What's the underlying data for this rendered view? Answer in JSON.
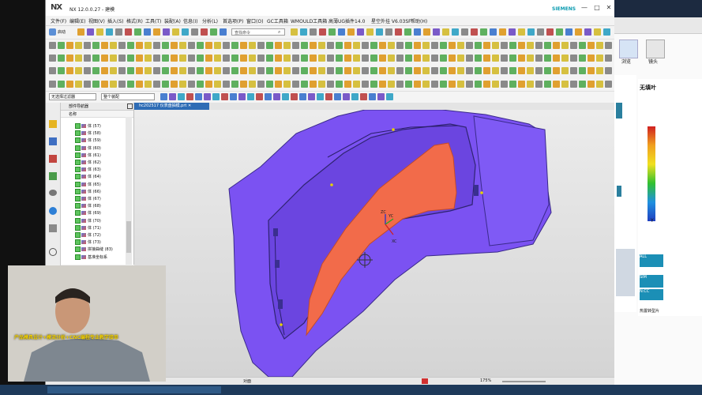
{
  "window": {
    "logo": "NX",
    "title": "NX 12.0.0.27 - 建模",
    "brand": "SIEMENS",
    "controls": [
      "—",
      "□",
      "✕"
    ]
  },
  "menu": [
    "文件(F)",
    "编辑(E)",
    "视图(V)",
    "插入(S)",
    "格式(R)",
    "工具(T)",
    "装配(A)",
    "信息(I)",
    "分析(L)",
    "首选项(P)",
    "窗口(O)",
    "GC工具箱",
    "WMOULD工具箱",
    "高薄UG插件14.0",
    "星空外挂 V6.03SF",
    "帮助(H)"
  ],
  "toolbar": {
    "start_label": "启动",
    "command_search_placeholder": "查找命令"
  },
  "selection": {
    "filter_value": "无选择过滤器",
    "scope_value": "整个装配"
  },
  "navigator": {
    "title": "部件导航器",
    "column_name": "名称",
    "rows": [
      "体 (57)",
      "体 (58)",
      "体 (59)",
      "体 (60)",
      "体 (61)",
      "体 (62)",
      "体 (63)",
      "体 (64)",
      "体 (65)",
      "体 (66)",
      "体 (67)",
      "体 (68)",
      "体 (69)",
      "体 (70)",
      "体 (71)",
      "体 (72)",
      "体 (73)",
      "拼接曲缝 (83)",
      "基准坐标系"
    ]
  },
  "file_tab": {
    "name": "hc202517 仪表盘抽模.prt"
  },
  "viewport": {
    "triad_labels": [
      "ZC",
      "YC",
      "XC"
    ],
    "part_color": "#7d55f0",
    "face_color": "#f26b4a"
  },
  "status": {
    "zoom": "175%",
    "left_text": "对面"
  },
  "right_app": {
    "button_labels": [
      "浏览",
      "镜头"
    ],
    "panel_title": "无填叶",
    "axis_y": "Y",
    "status_texts": [
      "ALL",
      "SIM",
      "N:CC"
    ],
    "bottom_label": "热置转型片"
  },
  "webcam": {
    "banner": "产品模具设计+模流分析+CNC编程专业教学接单"
  }
}
